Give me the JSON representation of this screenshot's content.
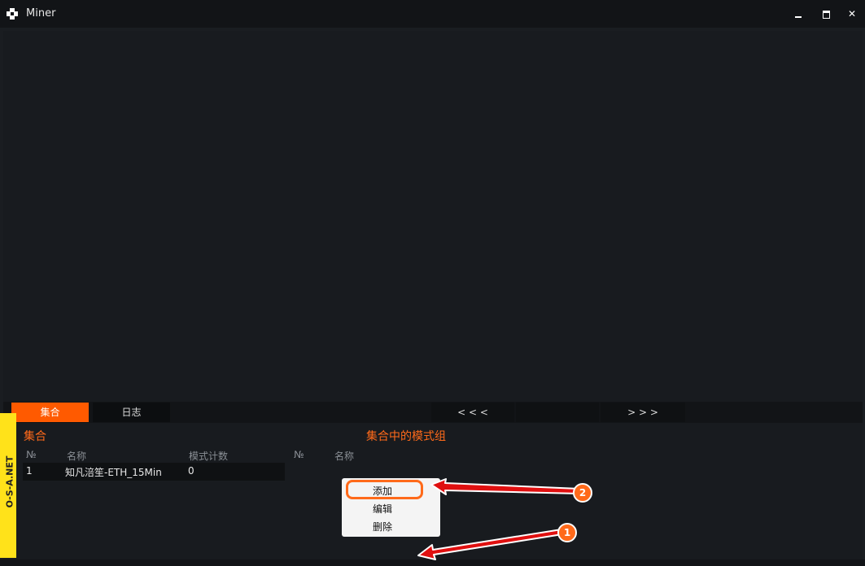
{
  "window": {
    "title": "Miner"
  },
  "tabs": {
    "collection": "集合",
    "log": "日志",
    "prev": "< < <",
    "next": "> > >"
  },
  "left_panel": {
    "title": "集合",
    "headers": [
      "№",
      "名称",
      "模式计数"
    ],
    "rows": [
      {
        "no": "1",
        "name": "知凡涪笙-ETH_15Min",
        "count": "0"
      }
    ]
  },
  "right_panel": {
    "title": "集合中的模式组",
    "headers": [
      "№",
      "名称"
    ]
  },
  "context_menu": {
    "items": [
      "添加",
      "编辑",
      "删除"
    ]
  },
  "annotations": {
    "badge_1": "1",
    "badge_2": "2"
  },
  "watermark": {
    "text": "O-S-A.NET"
  },
  "colors": {
    "accent": "#ff5a00",
    "arrow": "#e01010",
    "background": "#1a1d21"
  }
}
